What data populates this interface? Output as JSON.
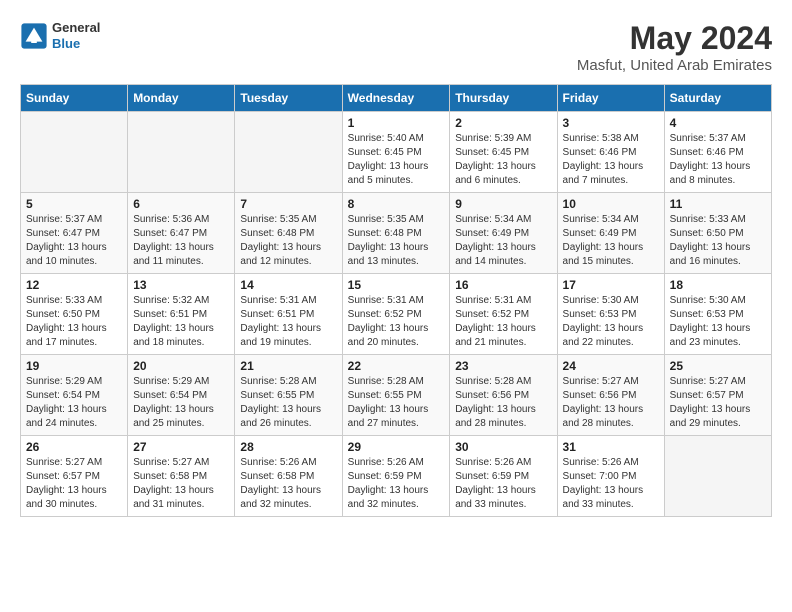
{
  "header": {
    "logo_general": "General",
    "logo_blue": "Blue",
    "month": "May 2024",
    "location": "Masfut, United Arab Emirates"
  },
  "days_of_week": [
    "Sunday",
    "Monday",
    "Tuesday",
    "Wednesday",
    "Thursday",
    "Friday",
    "Saturday"
  ],
  "weeks": [
    [
      {
        "day": "",
        "info": ""
      },
      {
        "day": "",
        "info": ""
      },
      {
        "day": "",
        "info": ""
      },
      {
        "day": "1",
        "info": "Sunrise: 5:40 AM\nSunset: 6:45 PM\nDaylight: 13 hours\nand 5 minutes."
      },
      {
        "day": "2",
        "info": "Sunrise: 5:39 AM\nSunset: 6:45 PM\nDaylight: 13 hours\nand 6 minutes."
      },
      {
        "day": "3",
        "info": "Sunrise: 5:38 AM\nSunset: 6:46 PM\nDaylight: 13 hours\nand 7 minutes."
      },
      {
        "day": "4",
        "info": "Sunrise: 5:37 AM\nSunset: 6:46 PM\nDaylight: 13 hours\nand 8 minutes."
      }
    ],
    [
      {
        "day": "5",
        "info": "Sunrise: 5:37 AM\nSunset: 6:47 PM\nDaylight: 13 hours\nand 10 minutes."
      },
      {
        "day": "6",
        "info": "Sunrise: 5:36 AM\nSunset: 6:47 PM\nDaylight: 13 hours\nand 11 minutes."
      },
      {
        "day": "7",
        "info": "Sunrise: 5:35 AM\nSunset: 6:48 PM\nDaylight: 13 hours\nand 12 minutes."
      },
      {
        "day": "8",
        "info": "Sunrise: 5:35 AM\nSunset: 6:48 PM\nDaylight: 13 hours\nand 13 minutes."
      },
      {
        "day": "9",
        "info": "Sunrise: 5:34 AM\nSunset: 6:49 PM\nDaylight: 13 hours\nand 14 minutes."
      },
      {
        "day": "10",
        "info": "Sunrise: 5:34 AM\nSunset: 6:49 PM\nDaylight: 13 hours\nand 15 minutes."
      },
      {
        "day": "11",
        "info": "Sunrise: 5:33 AM\nSunset: 6:50 PM\nDaylight: 13 hours\nand 16 minutes."
      }
    ],
    [
      {
        "day": "12",
        "info": "Sunrise: 5:33 AM\nSunset: 6:50 PM\nDaylight: 13 hours\nand 17 minutes."
      },
      {
        "day": "13",
        "info": "Sunrise: 5:32 AM\nSunset: 6:51 PM\nDaylight: 13 hours\nand 18 minutes."
      },
      {
        "day": "14",
        "info": "Sunrise: 5:31 AM\nSunset: 6:51 PM\nDaylight: 13 hours\nand 19 minutes."
      },
      {
        "day": "15",
        "info": "Sunrise: 5:31 AM\nSunset: 6:52 PM\nDaylight: 13 hours\nand 20 minutes."
      },
      {
        "day": "16",
        "info": "Sunrise: 5:31 AM\nSunset: 6:52 PM\nDaylight: 13 hours\nand 21 minutes."
      },
      {
        "day": "17",
        "info": "Sunrise: 5:30 AM\nSunset: 6:53 PM\nDaylight: 13 hours\nand 22 minutes."
      },
      {
        "day": "18",
        "info": "Sunrise: 5:30 AM\nSunset: 6:53 PM\nDaylight: 13 hours\nand 23 minutes."
      }
    ],
    [
      {
        "day": "19",
        "info": "Sunrise: 5:29 AM\nSunset: 6:54 PM\nDaylight: 13 hours\nand 24 minutes."
      },
      {
        "day": "20",
        "info": "Sunrise: 5:29 AM\nSunset: 6:54 PM\nDaylight: 13 hours\nand 25 minutes."
      },
      {
        "day": "21",
        "info": "Sunrise: 5:28 AM\nSunset: 6:55 PM\nDaylight: 13 hours\nand 26 minutes."
      },
      {
        "day": "22",
        "info": "Sunrise: 5:28 AM\nSunset: 6:55 PM\nDaylight: 13 hours\nand 27 minutes."
      },
      {
        "day": "23",
        "info": "Sunrise: 5:28 AM\nSunset: 6:56 PM\nDaylight: 13 hours\nand 28 minutes."
      },
      {
        "day": "24",
        "info": "Sunrise: 5:27 AM\nSunset: 6:56 PM\nDaylight: 13 hours\nand 28 minutes."
      },
      {
        "day": "25",
        "info": "Sunrise: 5:27 AM\nSunset: 6:57 PM\nDaylight: 13 hours\nand 29 minutes."
      }
    ],
    [
      {
        "day": "26",
        "info": "Sunrise: 5:27 AM\nSunset: 6:57 PM\nDaylight: 13 hours\nand 30 minutes."
      },
      {
        "day": "27",
        "info": "Sunrise: 5:27 AM\nSunset: 6:58 PM\nDaylight: 13 hours\nand 31 minutes."
      },
      {
        "day": "28",
        "info": "Sunrise: 5:26 AM\nSunset: 6:58 PM\nDaylight: 13 hours\nand 32 minutes."
      },
      {
        "day": "29",
        "info": "Sunrise: 5:26 AM\nSunset: 6:59 PM\nDaylight: 13 hours\nand 32 minutes."
      },
      {
        "day": "30",
        "info": "Sunrise: 5:26 AM\nSunset: 6:59 PM\nDaylight: 13 hours\nand 33 minutes."
      },
      {
        "day": "31",
        "info": "Sunrise: 5:26 AM\nSunset: 7:00 PM\nDaylight: 13 hours\nand 33 minutes."
      },
      {
        "day": "",
        "info": ""
      }
    ]
  ]
}
